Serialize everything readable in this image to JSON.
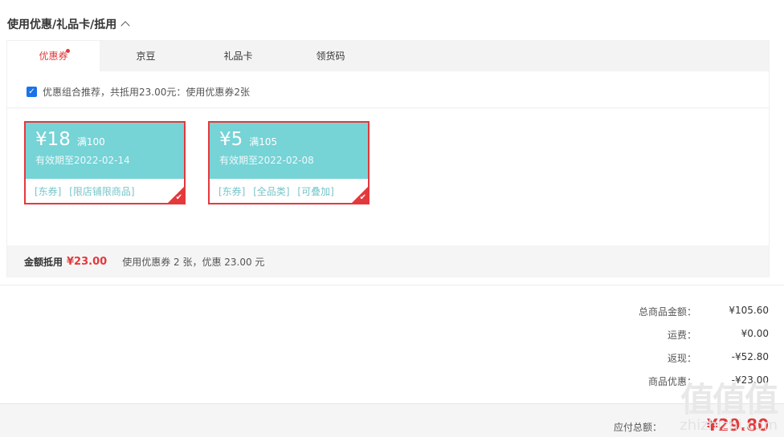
{
  "section": {
    "title": "使用优惠/礼品卡/抵用"
  },
  "tabs": [
    {
      "label": "优惠券",
      "active": true
    },
    {
      "label": "京豆",
      "active": false
    },
    {
      "label": "礼品卡",
      "active": false
    },
    {
      "label": "领货码",
      "active": false
    }
  ],
  "recommend": {
    "checked": true,
    "text": "优惠组合推荐，共抵用23.00元：使用优惠券2张"
  },
  "coupons": [
    {
      "amount": "¥18",
      "condition": "满100",
      "expiry": "有效期至2022-02-14",
      "tags": [
        "[东券]",
        "[限店铺限商品]"
      ],
      "selected": true
    },
    {
      "amount": "¥5",
      "condition": "满105",
      "expiry": "有效期至2022-02-08",
      "tags": [
        "[东券]",
        "[全品类]",
        "[可叠加]"
      ],
      "selected": true
    }
  ],
  "summary": {
    "label": "金额抵用",
    "amount": "¥23.00",
    "detail": "使用优惠券 2 张，优惠 23.00 元"
  },
  "totals": [
    {
      "label": "总商品金额：",
      "value": "¥105.60"
    },
    {
      "label": "运费：",
      "value": "¥0.00"
    },
    {
      "label": "返现：",
      "value": "-¥52.80"
    },
    {
      "label": "商品优惠：",
      "value": "-¥23.00"
    }
  ],
  "payable": {
    "label": "应付总额：",
    "value": "¥29.80"
  },
  "watermark": {
    "logo": "值值值",
    "text": "zhizhizhi.com"
  },
  "colors": {
    "accent": "#e4393c",
    "coupon": "#76d3d6",
    "checkbox": "#1a73e8"
  }
}
